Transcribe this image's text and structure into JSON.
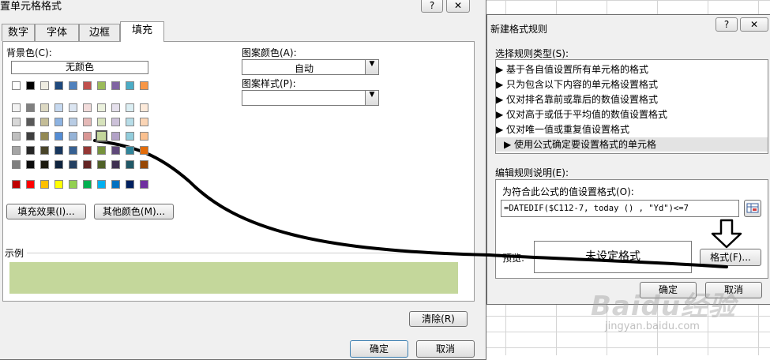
{
  "format_cells": {
    "title": "置单元格格式",
    "help": "?",
    "close": "✕",
    "tabs": [
      "数字",
      "字体",
      "边框",
      "填充"
    ],
    "bg_color_label": "背景色(C):",
    "no_color": "无颜色",
    "pattern_color_label": "图案颜色(A):",
    "pattern_color_value": "自动",
    "pattern_style_label": "图案样式(P):",
    "pattern_style_value": "",
    "fill_effects": "填充效果(I)...",
    "more_colors": "其他颜色(M)...",
    "sample_label": "示例",
    "sample_color": "#c4d79b",
    "clear": "清除(R)",
    "ok": "确定",
    "cancel": "取消"
  },
  "new_rule": {
    "title": "新建格式规则",
    "help": "?",
    "close": "✕",
    "select_type_label": "选择规则类型(S):",
    "rule_types": [
      "基于各自值设置所有单元格的格式",
      "只为包含以下内容的单元格设置格式",
      "仅对排名靠前或靠后的数值设置格式",
      "仅对高于或低于平均值的数值设置格式",
      "仅对唯一值或重复值设置格式",
      "使用公式确定要设置格式的单元格"
    ],
    "edit_desc_label": "编辑规则说明(E):",
    "formula_label": "为符合此公式的值设置格式(O):",
    "formula": "=DATEDIF($C112-7, today () , \"Yd\")<=7",
    "preview_label": "预览:",
    "preview_text": "未设定格式",
    "format_button": "格式(F)...",
    "ok": "确定",
    "cancel": "取消"
  },
  "watermark": {
    "logo": "Baidu经验",
    "url": "jingyan.baidu.com"
  },
  "palette": {
    "top_row": [
      "#ffffff",
      "#000000",
      "#eeece1",
      "#1f497d",
      "#4f81bd",
      "#c0504d",
      "#9bbb59",
      "#8064a2",
      "#4bacc6",
      "#f79646"
    ],
    "shade_rows": [
      [
        "#f2f2f2",
        "#808080",
        "#ddd9c3",
        "#c6d9f0",
        "#dbe5f1",
        "#f2dcdb",
        "#ebf1dd",
        "#e5e0ec",
        "#dbeef3",
        "#fdeada"
      ],
      [
        "#d8d8d8",
        "#595959",
        "#c4bd97",
        "#8db3e2",
        "#b8cce4",
        "#e5b9b7",
        "#d7e3bc",
        "#ccc1d9",
        "#b7dde8",
        "#fbd5b5"
      ],
      [
        "#bfbfbf",
        "#3f3f3f",
        "#938953",
        "#548dd4",
        "#95b3d7",
        "#d99694",
        "#c3d69b",
        "#b2a2c7",
        "#92cddc",
        "#fac08f"
      ],
      [
        "#a5a5a5",
        "#262626",
        "#494429",
        "#17365d",
        "#366092",
        "#953734",
        "#76923c",
        "#5f497a",
        "#31859b",
        "#e36c09"
      ],
      [
        "#7f7f7f",
        "#0c0c0c",
        "#1d1b10",
        "#0f243e",
        "#244061",
        "#632423",
        "#4f6128",
        "#3f3151",
        "#205867",
        "#974806"
      ]
    ],
    "standard_row": [
      "#c00000",
      "#ff0000",
      "#ffc000",
      "#ffff00",
      "#92d050",
      "#00b050",
      "#00b0f0",
      "#0070c0",
      "#002060",
      "#7030a0"
    ],
    "selected": "#c3d69b"
  }
}
